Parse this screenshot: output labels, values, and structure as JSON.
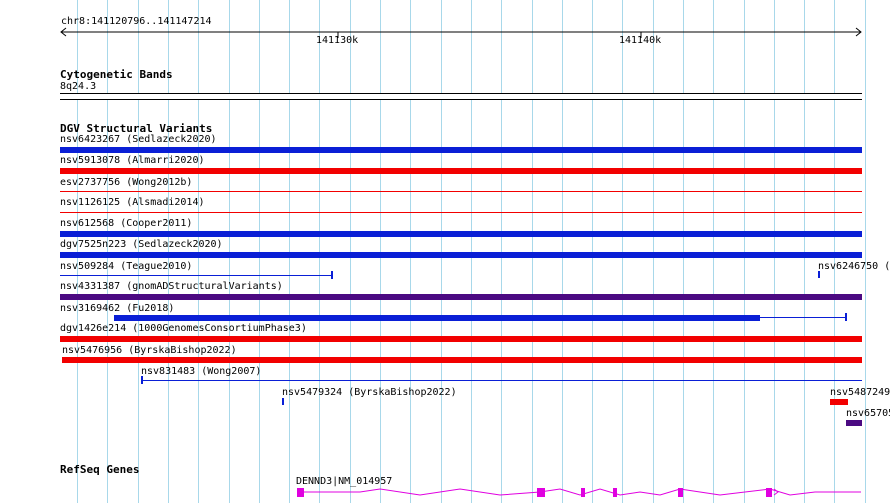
{
  "colors": {
    "grid": "#a8d8ea",
    "blue": "#0a1fd6",
    "red": "#f20000",
    "purple": "#4b0a82",
    "gene": "#e000e0"
  },
  "ruler": {
    "label": "chr8:141120796..141147214",
    "tick_labels": [
      "141130k",
      "141140k"
    ]
  },
  "cyto": {
    "header": "Cytogenetic Bands",
    "band": "8q24.3"
  },
  "dgv": {
    "header": "DGV Structural Variants",
    "labels": {
      "v1": "nsv6423267 (Sedlazeck2020)",
      "v2": "nsv5913078 (Almarri2020)",
      "v3": "esv2737756 (Wong2012b)",
      "v4": "nsv1126125 (Alsmadi2014)",
      "v5": "nsv612568 (Cooper2011)",
      "v6": "dgv7525n223 (Sedlazeck2020)",
      "v7": "nsv509284 (Teague2010)",
      "v7b": "nsv6246750 (",
      "v8": "nsv4331387 (gnomADStructuralVariants)",
      "v9": "nsv3169462 (Fu2018)",
      "v10": "dgv1426e214 (1000GenomesConsortiumPhase3)",
      "v11": "nsv5476956 (ByrskaBishop2022)",
      "v12": "nsv831483 (Wong2007)",
      "v13": "nsv5479324 (ByrskaBishop2022)",
      "v14": "nsv5487249",
      "v15": "nsv65705"
    }
  },
  "refseq": {
    "header": "RefSeq Genes",
    "gene_label": "DENND3|NM_014957"
  }
}
